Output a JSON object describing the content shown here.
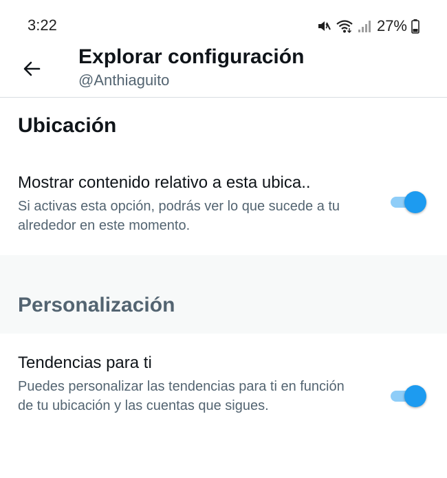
{
  "status_bar": {
    "time": "3:22",
    "battery_percent": "27%"
  },
  "header": {
    "title": "Explorar configuración",
    "handle": "@Anthiaguito"
  },
  "sections": [
    {
      "title": "Ubicación",
      "settings": [
        {
          "title": "Mostrar contenido relativo a esta ubica..",
          "description": "Si activas esta opción, podrás ver lo que sucede a tu alrededor en este momento.",
          "enabled": true
        }
      ]
    },
    {
      "title": "Personalización",
      "settings": [
        {
          "title": "Tendencias para ti",
          "description": "Puedes personalizar las tendencias para ti en función de tu ubicación y las cuentas que sigues.",
          "enabled": true
        }
      ]
    }
  ],
  "colors": {
    "accent": "#1d9bf0",
    "toggle_track_on": "#8ecdf8",
    "secondary_text": "#536471",
    "section_background": "#f7f9f9"
  },
  "icons": {
    "back": "arrow-left-icon",
    "mute": "vibrate-mute-icon",
    "wifi": "wifi-icon",
    "signal": "cell-signal-icon",
    "battery": "battery-icon"
  }
}
